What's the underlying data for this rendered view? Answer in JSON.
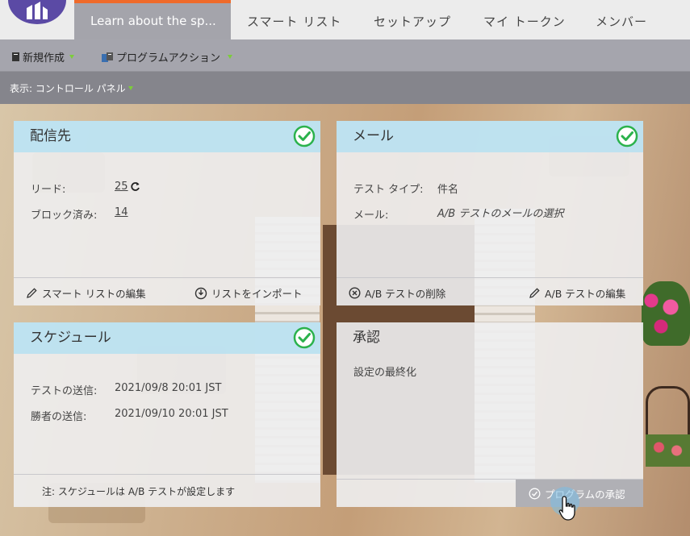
{
  "nav": {
    "active_tab": "Learn about the sp...",
    "tabs": [
      "スマート リスト",
      "セットアップ",
      "マイ トークン",
      "メンバー"
    ]
  },
  "toolbar": {
    "new_label": "新規作成",
    "program_actions_label": "プログラムアクション"
  },
  "viewbar": {
    "view_label": "表示: コントロール パネル"
  },
  "audience": {
    "title": "配信先",
    "leads_label": "リード:",
    "leads_value": "25",
    "blocked_label": "ブロック済み:",
    "blocked_value": "14",
    "edit_smart_list": "スマート リストの編集",
    "import_list": "リストをインポート"
  },
  "email": {
    "title": "メール",
    "test_type_label": "テスト タイプ:",
    "test_type_value": "件名",
    "mail_label": "メール:",
    "mail_value": "A/B テストのメールの選択",
    "delete_ab": "A/B テストの削除",
    "edit_ab": "A/B テストの編集"
  },
  "schedule": {
    "title": "スケジュール",
    "test_send_label": "テストの送信:",
    "test_send_value": "2021/09/8 20:01 JST",
    "winner_send_label": "勝者の送信:",
    "winner_send_value": "2021/09/10 20:01 JST",
    "note": "注: スケジュールは A/B テストが設定します"
  },
  "approval": {
    "title": "承認",
    "status": "設定の最終化",
    "approve_button": "プログラムの承認"
  },
  "colors": {
    "accent_orange": "#ef6a2a",
    "check_green": "#2bb24c",
    "header_blue": "#bae1f0",
    "logo_purple": "#5b4aa5"
  }
}
